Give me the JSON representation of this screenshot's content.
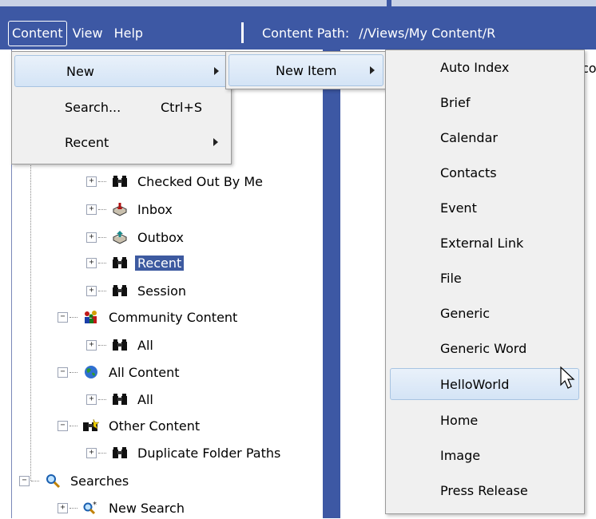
{
  "menubar": {
    "items": [
      "Content",
      "View",
      "Help"
    ],
    "path_label": "Content Path:",
    "path_value": "//Views/My Content/R",
    "peek_text": "co"
  },
  "tree": {
    "rows": [
      {
        "label": "Checked Out By Me",
        "icon": "binoculars-icon"
      },
      {
        "label": "Inbox",
        "icon": "inbox-icon"
      },
      {
        "label": "Outbox",
        "icon": "outbox-icon"
      },
      {
        "label": "Recent",
        "icon": "binoculars-icon",
        "selected": true
      },
      {
        "label": "Session",
        "icon": "binoculars-icon"
      },
      {
        "label": "Community Content",
        "icon": "people-icon"
      },
      {
        "label": "All",
        "icon": "binoculars-icon"
      },
      {
        "label": "All Content",
        "icon": "globe-icon"
      },
      {
        "label": "All",
        "icon": "binoculars-icon"
      },
      {
        "label": "Other Content",
        "icon": "binoculars-star-icon"
      },
      {
        "label": "Duplicate Folder Paths",
        "icon": "binoculars-icon"
      },
      {
        "label": "Searches",
        "icon": "magnifier-icon"
      },
      {
        "label": "New Search",
        "icon": "new-search-icon"
      }
    ]
  },
  "content_menu": {
    "items": [
      {
        "label": "New",
        "shortcut": "",
        "submenu": true
      },
      {
        "label": "Search...",
        "shortcut": "Ctrl+S",
        "submenu": false
      },
      {
        "label": "Recent",
        "shortcut": "",
        "submenu": true
      }
    ]
  },
  "new_menu": {
    "items": [
      {
        "label": "New Item",
        "submenu": true
      }
    ]
  },
  "new_item_menu": {
    "items": [
      "Auto Index",
      "Brief",
      "Calendar",
      "Contacts",
      "Event",
      "External Link",
      "File",
      "Generic",
      "Generic Word",
      "HelloWorld",
      "Home",
      "Image",
      "Press Release"
    ],
    "highlighted": "HelloWorld"
  },
  "colors": {
    "toolbar": "#3d58a4",
    "selection": "#3d5aa0",
    "menu_bg": "#f0f0f0"
  }
}
